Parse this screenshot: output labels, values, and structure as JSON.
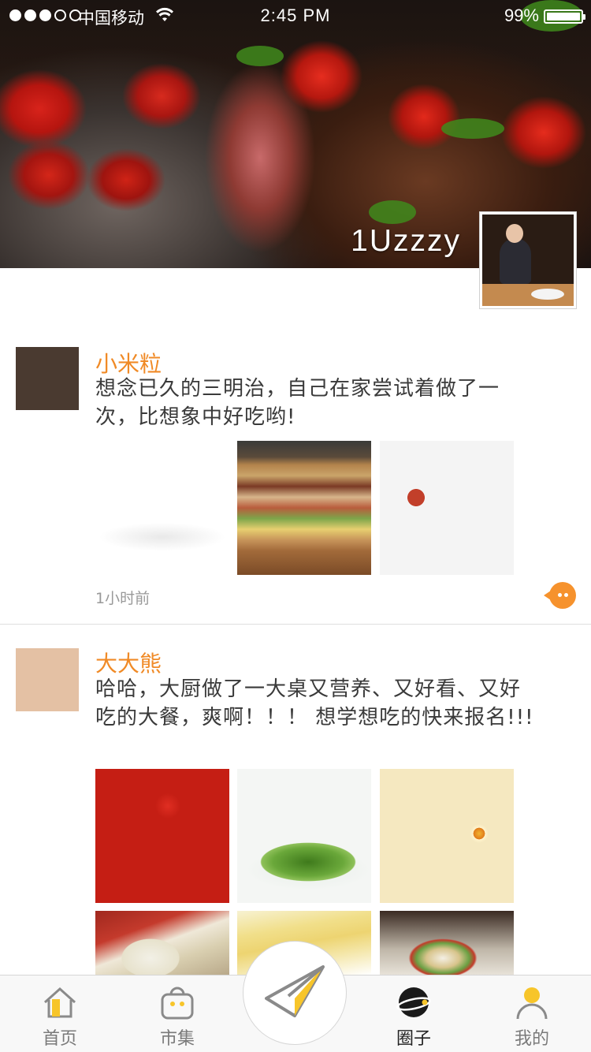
{
  "status_bar": {
    "carrier": "中国移动",
    "time": "2:45 PM",
    "battery": "99%",
    "signal_bars": 3
  },
  "profile": {
    "username": "1Uzzzy"
  },
  "posts": [
    {
      "author": "小米粒",
      "text": "想念已久的三明治，自己在家尝试着做了一次，比想象中好吃哟!",
      "time": "1小时前",
      "photos": [
        "sandwich",
        "club-sandwich",
        "sandwich-platter"
      ]
    },
    {
      "author": "大大熊",
      "text": "哈哈，大厨做了一大桌又营养、又好看、又好吃的大餐，爽啊！！！ 想学想吃的快来报名!!!",
      "photos": [
        "braised-meat",
        "salad",
        "ramen",
        "dumplings",
        "omelet",
        "platter"
      ]
    }
  ],
  "tabbar": {
    "items": [
      {
        "label": "首页",
        "icon": "home-icon",
        "active": false
      },
      {
        "label": "市集",
        "icon": "bag-icon",
        "active": false
      },
      {
        "label": "圈子",
        "icon": "planet-icon",
        "active": true
      },
      {
        "label": "我的",
        "icon": "user-icon",
        "active": false
      }
    ],
    "center_icon": "paper-plane-icon"
  },
  "colors": {
    "accent": "#f08a26",
    "comment": "#f6922d",
    "icon_yellow": "#f7c52a"
  }
}
